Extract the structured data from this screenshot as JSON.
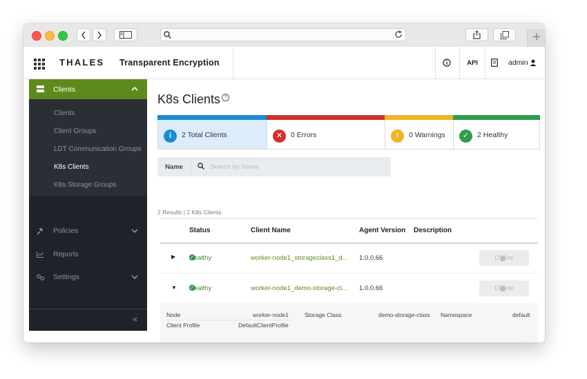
{
  "browser": {
    "new_tab_label": "+"
  },
  "header": {
    "logo": "THALES",
    "product": "Transparent Encryption",
    "info_label": "ⓘ",
    "api_label": "API",
    "user_label": "admin"
  },
  "sidebar": {
    "active_section": "Clients",
    "sub_items": [
      {
        "label": "Clients",
        "current": false
      },
      {
        "label": "Client Groups",
        "current": false
      },
      {
        "label": "LDT Communication Groups",
        "current": false
      },
      {
        "label": "K8s Clients",
        "current": true
      },
      {
        "label": "K8s Storage Groups",
        "current": false
      }
    ],
    "sections": [
      "Policies",
      "Reports",
      "Settings"
    ],
    "collapse_label": "«"
  },
  "page": {
    "title": "K8s Clients",
    "help_icon": "?"
  },
  "stats": [
    {
      "label": "2 Total Clients",
      "icon": "i",
      "color": "#1c8ad8"
    },
    {
      "label": "0 Errors",
      "icon": "✕",
      "color": "#d0312d"
    },
    {
      "label": "0 Warnings",
      "icon": "!",
      "color": "#f0b323"
    },
    {
      "label": "2 Healthy",
      "icon": "✓",
      "color": "#2e9e49"
    }
  ],
  "search": {
    "label": "Name",
    "placeholder": "Search by Name"
  },
  "results_text": "2 Results | 2 K8s Clients",
  "table": {
    "columns": [
      "Status",
      "Client Name",
      "Agent Version",
      "Description"
    ],
    "rows": [
      {
        "status": "Healthy",
        "client_name": "worker-node1_storageclass1_d...",
        "agent_version": "1.0.0.66",
        "description": "",
        "expanded": false
      },
      {
        "status": "Healthy",
        "client_name": "worker-node1_demo-storage-cl...",
        "agent_version": "1.0.0.66",
        "description": "",
        "expanded": true
      }
    ],
    "delete_label": "Delete",
    "detail": {
      "node_label": "Node",
      "node_value": "worker-node1",
      "storage_class_label": "Storage Class",
      "storage_class_value": "demo-storage-class",
      "namespace_label": "Namespace",
      "namespace_value": "default",
      "client_profile_label": "Client Profile",
      "client_profile_value": "DefaultClientProfile"
    }
  }
}
